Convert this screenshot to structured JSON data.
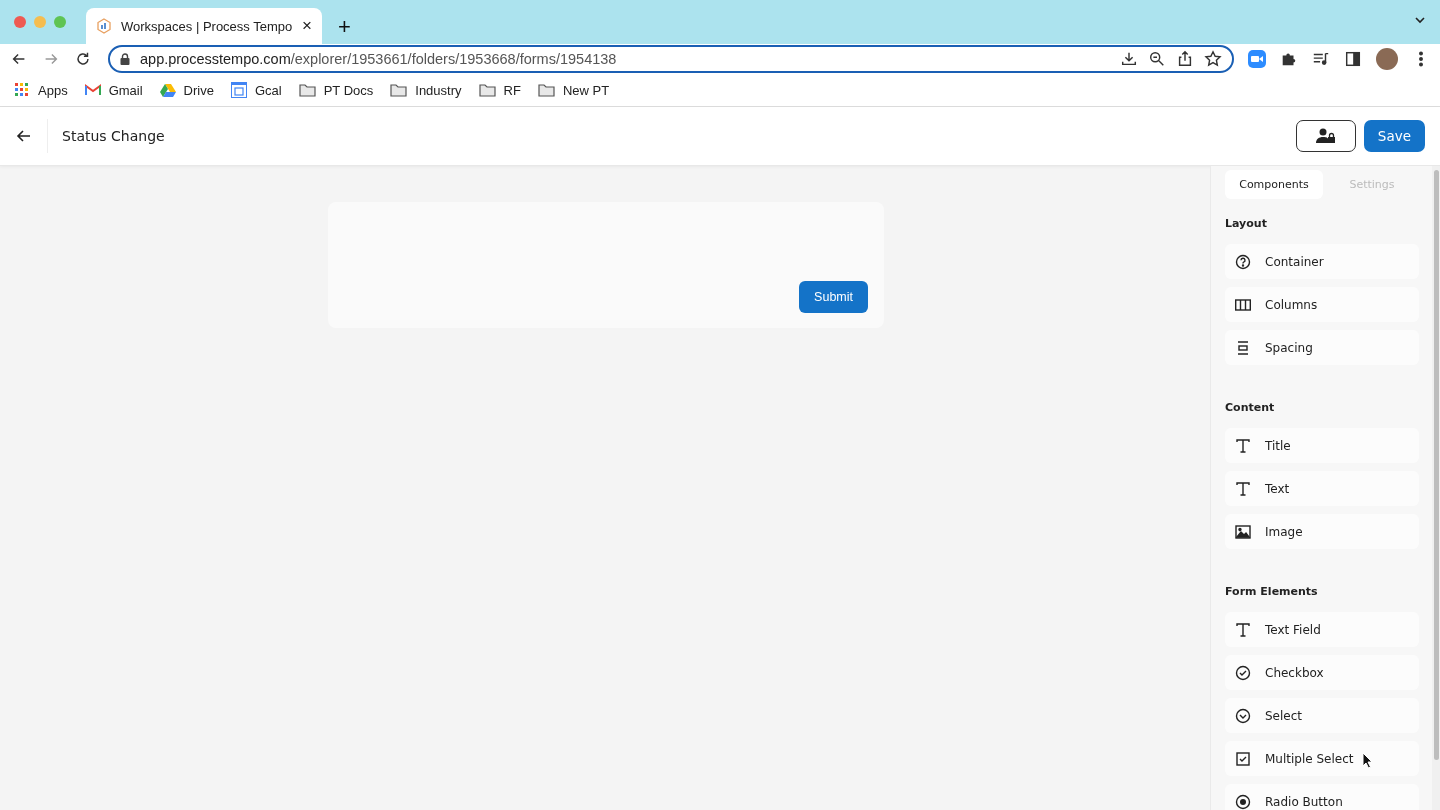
{
  "browser": {
    "tab": {
      "title": "Workspaces | Process Tempo",
      "close": "×"
    },
    "new_tab": "+",
    "url": {
      "host": "app.processtempo.com",
      "path": "/explorer/1953661/folders/1953668/forms/1954138"
    },
    "bookmarks": [
      {
        "kind": "apps",
        "label": "Apps"
      },
      {
        "kind": "gmail",
        "label": "Gmail"
      },
      {
        "kind": "drive",
        "label": "Drive"
      },
      {
        "kind": "calendar",
        "label": "Gcal"
      },
      {
        "kind": "folder",
        "label": "PT Docs"
      },
      {
        "kind": "folder",
        "label": "Industry"
      },
      {
        "kind": "folder",
        "label": "RF"
      },
      {
        "kind": "folder",
        "label": "New PT"
      }
    ]
  },
  "header": {
    "title": "Status Change",
    "save": "Save"
  },
  "form": {
    "submit": "Submit"
  },
  "panel": {
    "tabs": [
      {
        "label": "Components",
        "selected": true
      },
      {
        "label": "Settings",
        "selected": false
      }
    ],
    "sections": [
      {
        "title": "Layout",
        "items": [
          {
            "kind": "help-circle",
            "label": "Container"
          },
          {
            "kind": "columns",
            "label": "Columns"
          },
          {
            "kind": "spacing",
            "label": "Spacing"
          }
        ]
      },
      {
        "title": "Content",
        "items": [
          {
            "kind": "type",
            "label": "Title"
          },
          {
            "kind": "type",
            "label": "Text"
          },
          {
            "kind": "image",
            "label": "Image"
          }
        ]
      },
      {
        "title": "Form Elements",
        "items": [
          {
            "kind": "type",
            "label": "Text Field"
          },
          {
            "kind": "check-circle",
            "label": "Checkbox"
          },
          {
            "kind": "chevron-circle",
            "label": "Select"
          },
          {
            "kind": "check-square",
            "label": "Multiple Select"
          },
          {
            "kind": "radio",
            "label": "Radio Button"
          }
        ]
      }
    ]
  }
}
